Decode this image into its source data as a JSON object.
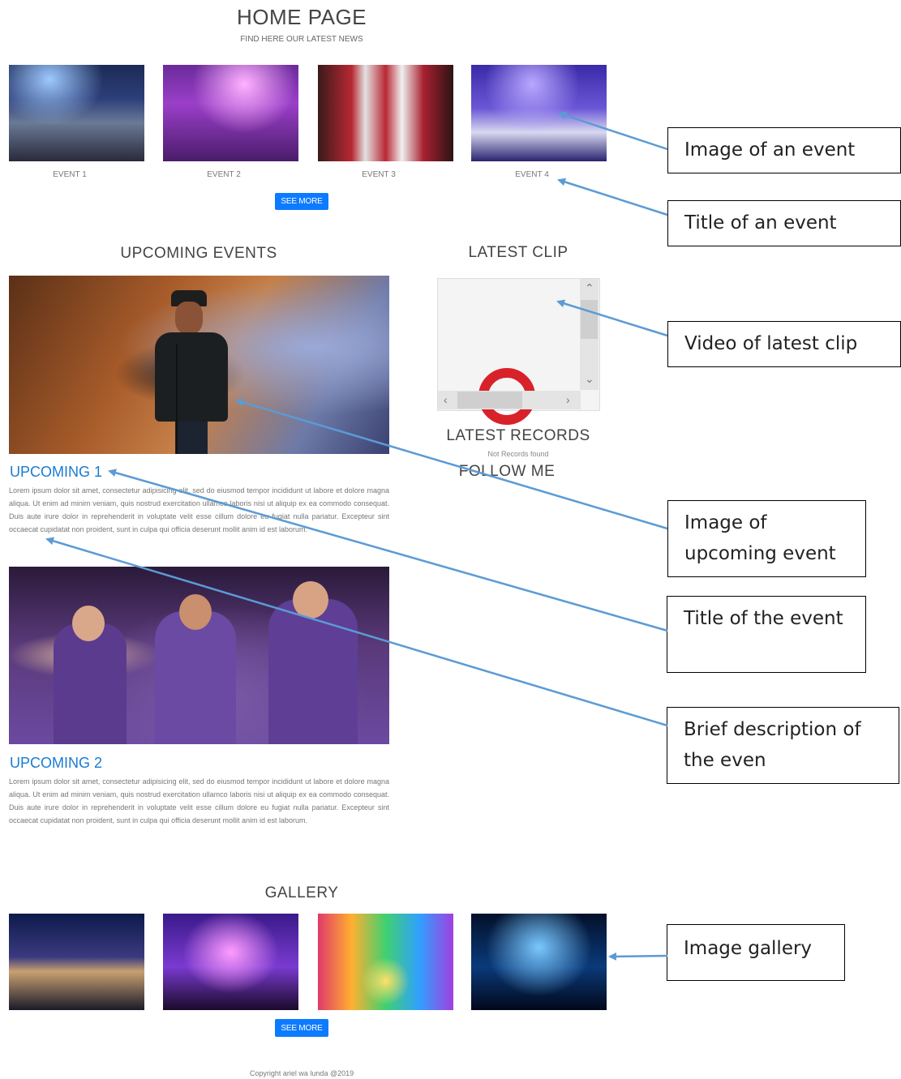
{
  "header": {
    "title": "HOME PAGE",
    "subtitle": "FIND HERE OUR LATEST NEWS"
  },
  "events": [
    {
      "title": "EVENT 1"
    },
    {
      "title": "EVENT 2"
    },
    {
      "title": "EVENT 3"
    },
    {
      "title": "EVENT 4"
    }
  ],
  "buttons": {
    "see_more_events": "SEE MORE",
    "see_more_gallery": "SEE MORE"
  },
  "upcoming": {
    "heading": "UPCOMING EVENTS",
    "items": [
      {
        "title": "UPCOMING 1",
        "description": "Lorem ipsum dolor sit amet, consectetur adipisicing elit, sed do eiusmod tempor incididunt ut labore et dolore magna aliqua. Ut enim ad minim veniam, quis nostrud exercitation ullamco laboris nisi ut aliquip ex ea commodo consequat. Duis aute irure dolor in reprehenderit in voluptate velit esse cillum dolore eu fugiat nulla pariatur. Excepteur sint occaecat cupidatat non proident, sunt in culpa qui officia deserunt mollit anim id est laborum."
      },
      {
        "title": "UPCOMING 2",
        "description": "Lorem ipsum dolor sit amet, consectetur adipisicing elit, sed do eiusmod tempor incididunt ut labore et dolore magna aliqua. Ut enim ad minim veniam, quis nostrud exercitation ullamco laboris nisi ut aliquip ex ea commodo consequat. Duis aute irure dolor in reprehenderit in voluptate velit esse cillum dolore eu fugiat nulla pariatur. Excepteur sint occaecat cupidatat non proident, sunt in culpa qui officia deserunt mollit anim id est laborum."
      }
    ]
  },
  "sidebar": {
    "latest_clip": "LATEST CLIP",
    "latest_records": "LATEST RECORDS",
    "no_records": "Not Records found",
    "follow_me": "FOLLOW ME"
  },
  "gallery": {
    "heading": "GALLERY"
  },
  "footer": {
    "copyright": "Copyright ariel wa lunda @2019"
  },
  "callouts": {
    "event_image": "Image of an event",
    "event_title": "Title of an event",
    "video": "Video of latest clip",
    "upcoming_image": "Image of upcoming event",
    "upcoming_title": "Title of the event",
    "description": "Brief description of the even",
    "gallery": "Image gallery"
  },
  "colors": {
    "accent": "#0d7bff",
    "title_blue": "#1a7bd0",
    "arrow": "#5b9bd5",
    "play_red": "#d8222a"
  },
  "icons": {
    "scroll_up": "chevron-up-icon",
    "scroll_down": "chevron-down-icon",
    "scroll_left": "chevron-left-icon",
    "scroll_right": "chevron-right-icon"
  }
}
